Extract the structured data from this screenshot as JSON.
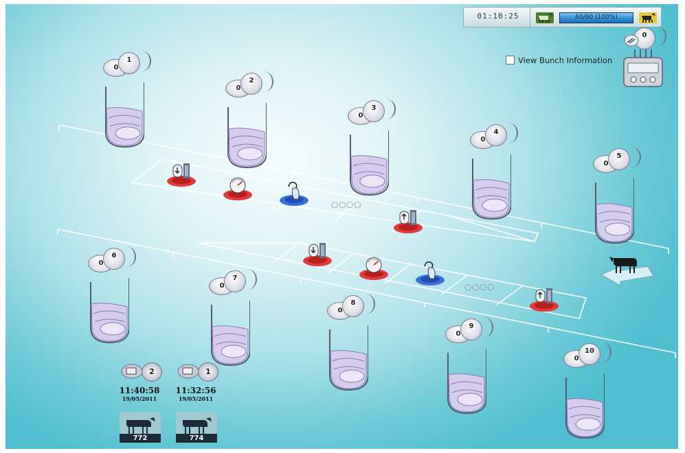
{
  "status_bar": {
    "clock": "01:10:25",
    "progress_label": "60/60 (100%)",
    "progress_fraction": 1.0
  },
  "view_bunch": {
    "label": "View Bunch Information",
    "checked": false
  },
  "wash_unit": {
    "count": "0"
  },
  "units": [
    {
      "number": "1",
      "count": "0"
    },
    {
      "number": "2",
      "count": "0"
    },
    {
      "number": "3",
      "count": "0"
    },
    {
      "number": "4",
      "count": "0"
    },
    {
      "number": "5",
      "count": "0"
    },
    {
      "number": "6",
      "count": "0"
    },
    {
      "number": "7",
      "count": "0"
    },
    {
      "number": "8",
      "count": "0"
    },
    {
      "number": "9",
      "count": "0"
    },
    {
      "number": "10",
      "count": "0"
    }
  ],
  "recent_cows": [
    {
      "count": "2",
      "time": "11:40:58",
      "date": "19/05/2011",
      "cow_id": "772"
    },
    {
      "count": "1",
      "time": "11:32:56",
      "date": "19/05/2011",
      "cow_id": "774"
    }
  ],
  "colors": {
    "red_disc": "#e03a3a",
    "blue_disc": "#3a6fdc",
    "accent_bar": "#2f8ad2"
  },
  "icons": {
    "row_a": [
      "gate-down-icon",
      "gauge-icon",
      "teat-dip-icon",
      "teat-cups-icon",
      "gate-up-icon"
    ],
    "row_b": [
      "gate-down-icon",
      "gauge-icon",
      "teat-dip-icon",
      "teat-cups-icon",
      "gate-up-icon"
    ]
  }
}
